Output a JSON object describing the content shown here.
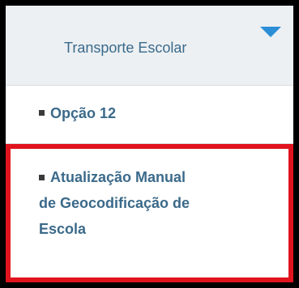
{
  "header": {
    "title": "Transporte Escolar",
    "caret_icon": "caret-down-icon",
    "caret_color": "#2c8ed6"
  },
  "menu": {
    "items": [
      {
        "label": "Opção 12",
        "highlighted": false
      },
      {
        "label_lines": [
          "Atualização Manual",
          "de Geocodificação de",
          "Escola"
        ],
        "highlighted": true,
        "highlight_color": "#e0141e"
      }
    ]
  },
  "colors": {
    "text": "#3b6a8a",
    "header_bg": "#ecf0f3",
    "frame": "#000000"
  }
}
